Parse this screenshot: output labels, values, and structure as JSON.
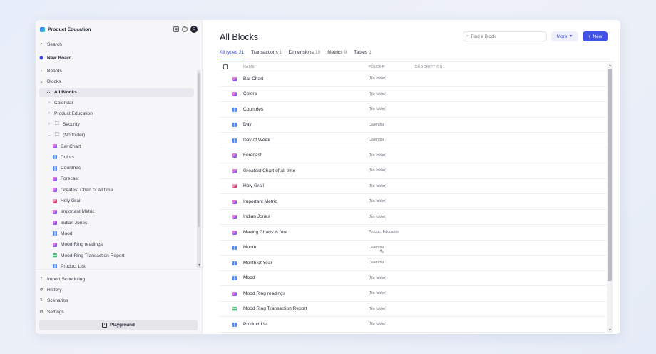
{
  "sidebar": {
    "workspace": "Product Education",
    "avatar": "C",
    "search": "Search",
    "new_board": "New Board",
    "boards": "Boards",
    "blocks": "Blocks",
    "all_blocks": "All Blocks",
    "folders": [
      "Calendar",
      "Product Education",
      "Security",
      "(No folder)"
    ],
    "items": [
      {
        "label": "Bar Chart",
        "type": "metric"
      },
      {
        "label": "Colors",
        "type": "dim"
      },
      {
        "label": "Countries",
        "type": "dim"
      },
      {
        "label": "Forecast",
        "type": "metric"
      },
      {
        "label": "Greatest Chart of all time",
        "type": "metric"
      },
      {
        "label": "Holy Grail",
        "type": "red"
      },
      {
        "label": "Important Metric",
        "type": "metric"
      },
      {
        "label": "Indian Jones",
        "type": "metric"
      },
      {
        "label": "Mood",
        "type": "dim"
      },
      {
        "label": "Mood Ring readings",
        "type": "metric"
      },
      {
        "label": "Mood Ring Transaction Report",
        "type": "txn"
      },
      {
        "label": "Product List",
        "type": "dim"
      }
    ],
    "bottom": [
      "Import Scheduling",
      "History",
      "Scenarios",
      "Settings"
    ],
    "playground": "Playground"
  },
  "main": {
    "title": "All Blocks",
    "search_placeholder": "Find a Block",
    "more_label": "More",
    "new_label": "New",
    "tabs": [
      {
        "label": "All types",
        "count": "21",
        "active": true
      },
      {
        "label": "Transactions",
        "count": "1"
      },
      {
        "label": "Dimensions",
        "count": "10"
      },
      {
        "label": "Metrics",
        "count": "9"
      },
      {
        "label": "Tables",
        "count": "1"
      }
    ],
    "columns": {
      "name": "NAME",
      "folder": "FOLDER",
      "description": "DESCRIPTION"
    },
    "rows": [
      {
        "name": "Bar Chart",
        "folder": "(No folder)",
        "type": "metric"
      },
      {
        "name": "Colors",
        "folder": "(No folder)",
        "type": "metric"
      },
      {
        "name": "Countries",
        "folder": "(No folder)",
        "type": "dim"
      },
      {
        "name": "Day",
        "folder": "Calendar",
        "type": "dim"
      },
      {
        "name": "Day of Week",
        "folder": "Calendar",
        "type": "dim"
      },
      {
        "name": "Forecast",
        "folder": "(No folder)",
        "type": "metric"
      },
      {
        "name": "Greatest Chart of all time",
        "folder": "(No folder)",
        "type": "metric"
      },
      {
        "name": "Holy Grail",
        "folder": "(No folder)",
        "type": "red"
      },
      {
        "name": "Important Metric",
        "folder": "(No folder)",
        "type": "metric"
      },
      {
        "name": "Indian Jones",
        "folder": "(No folder)",
        "type": "metric"
      },
      {
        "name": "Making Charts is fun!",
        "folder": "Product Education",
        "type": "metric"
      },
      {
        "name": "Month",
        "folder": "Calendar",
        "type": "dim"
      },
      {
        "name": "Month of Year",
        "folder": "Calendar",
        "type": "dim"
      },
      {
        "name": "Mood",
        "folder": "(No folder)",
        "type": "dim"
      },
      {
        "name": "Mood Ring readings",
        "folder": "(No folder)",
        "type": "metric"
      },
      {
        "name": "Mood Ring Transaction Report",
        "folder": "(No folder)",
        "type": "txn"
      },
      {
        "name": "Product List",
        "folder": "(No folder)",
        "type": "dim"
      }
    ]
  },
  "colors": {
    "accent": "#4352e6",
    "sidebar_bg": "#f7f7f9",
    "selected": "#e9e8ef"
  }
}
